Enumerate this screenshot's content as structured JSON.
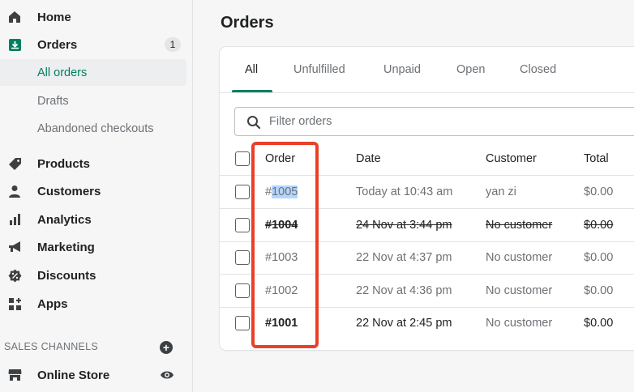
{
  "sidebar": {
    "items": [
      {
        "label": "Home",
        "icon": "home-icon"
      },
      {
        "label": "Orders",
        "icon": "orders-icon",
        "badge": "1"
      },
      {
        "label": "Products",
        "icon": "tag-icon"
      },
      {
        "label": "Customers",
        "icon": "person-icon"
      },
      {
        "label": "Analytics",
        "icon": "bar-chart-icon"
      },
      {
        "label": "Marketing",
        "icon": "megaphone-icon"
      },
      {
        "label": "Discounts",
        "icon": "discount-icon"
      },
      {
        "label": "Apps",
        "icon": "apps-icon"
      }
    ],
    "order_subitems": [
      {
        "label": "All orders"
      },
      {
        "label": "Drafts"
      },
      {
        "label": "Abandoned checkouts"
      }
    ],
    "sales_channels_title": "SALES CHANNELS",
    "channel": {
      "label": "Online Store",
      "icon": "store-icon"
    }
  },
  "main": {
    "title": "Orders",
    "tabs": [
      {
        "label": "All"
      },
      {
        "label": "Unfulfilled"
      },
      {
        "label": "Unpaid"
      },
      {
        "label": "Open"
      },
      {
        "label": "Closed"
      }
    ],
    "search_placeholder": "Filter orders",
    "columns": [
      "Order",
      "Date",
      "Customer",
      "Total"
    ],
    "rows": [
      {
        "order_prefix": "#",
        "order_selected": "1005",
        "date": "Today at 10:43 am",
        "customer": "yan zi",
        "total": "$0.00"
      },
      {
        "order": "#1004",
        "date": "24 Nov at 3:44 pm",
        "customer": "No customer",
        "total": "$0.00"
      },
      {
        "order": "#1003",
        "date": "22 Nov at 4:37 pm",
        "customer": "No customer",
        "total": "$0.00"
      },
      {
        "order": "#1002",
        "date": "22 Nov at 4:36 pm",
        "customer": "No customer",
        "total": "$0.00"
      },
      {
        "order": "#1001",
        "date": "22 Nov at 2:45 pm",
        "customer": "No customer",
        "total": "$0.00"
      }
    ]
  },
  "colors": {
    "accent": "#008060",
    "highlight": "#e8402a"
  }
}
